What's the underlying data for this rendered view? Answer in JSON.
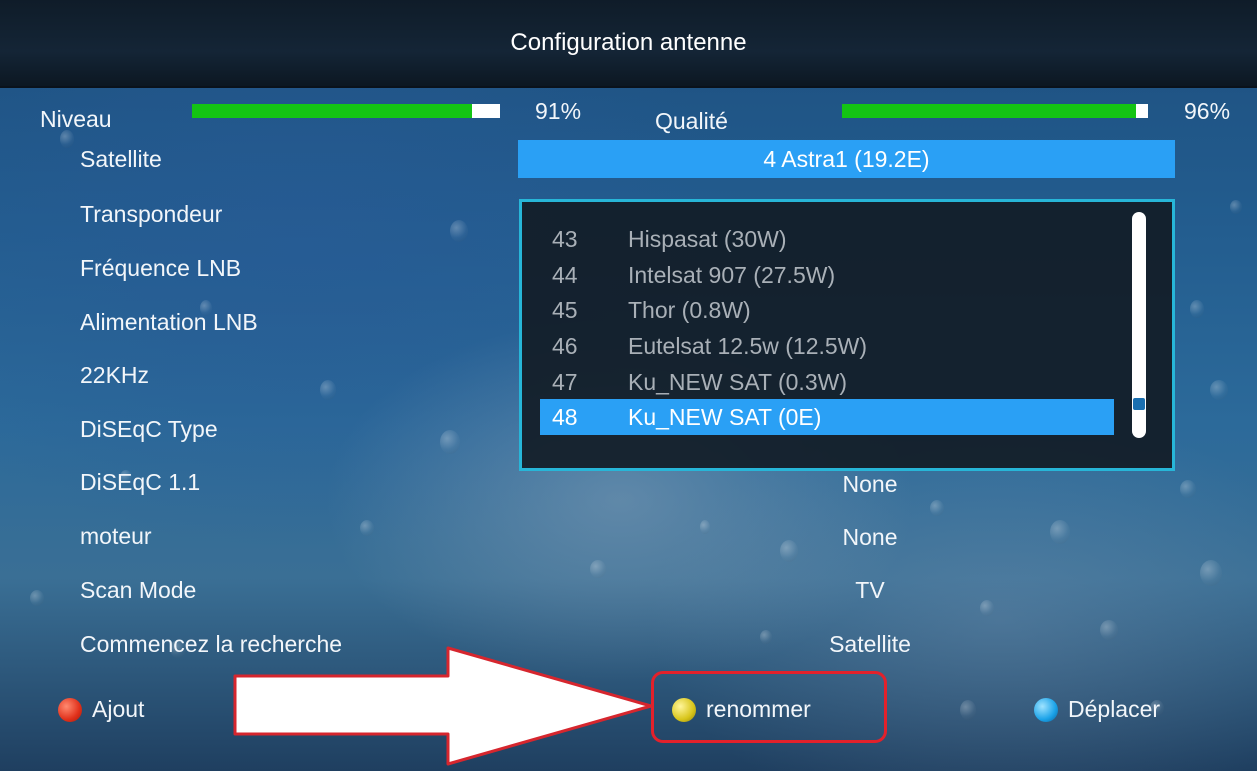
{
  "header": {
    "title": "Configuration antenne"
  },
  "signal": {
    "level_label": "Niveau",
    "level_value": "91%",
    "level_fraction": 0.91,
    "quality_label": "Qualité",
    "quality_value": "96%",
    "quality_fraction": 0.96,
    "bar_fill_color": "#14c414"
  },
  "settings": [
    {
      "label": "Satellite"
    },
    {
      "label": "Transpondeur"
    },
    {
      "label": "Fréquence LNB"
    },
    {
      "label": "Alimentation LNB"
    },
    {
      "label": "22KHz"
    },
    {
      "label": "DiSEqC Type"
    },
    {
      "label": "DiSEqC 1.1",
      "value": "None"
    },
    {
      "label": "moteur",
      "value": "None"
    },
    {
      "label": "Scan Mode",
      "value": "TV"
    },
    {
      "label": "Commencez la recherche",
      "value": "Satellite"
    }
  ],
  "satellite_field": {
    "value": "4 Astra1 (19.2E)"
  },
  "satellite_list": [
    {
      "num": "43",
      "name": "Hispasat (30W)"
    },
    {
      "num": "44",
      "name": "Intelsat 907 (27.5W)"
    },
    {
      "num": "45",
      "name": "Thor (0.8W)"
    },
    {
      "num": "46",
      "name": "Eutelsat 12.5w (12.5W)"
    },
    {
      "num": "47",
      "name": "Ku_NEW SAT (0.3W)"
    },
    {
      "num": "48",
      "name": "Ku_NEW SAT (0E)",
      "selected": true
    }
  ],
  "footer": {
    "red": {
      "label": "Ajout",
      "icon": "red-button-icon"
    },
    "yellow": {
      "label": "renommer",
      "icon": "yellow-button-icon"
    },
    "blue": {
      "label": "Déplacer",
      "icon": "blue-button-icon"
    }
  },
  "colors": {
    "accent": "#2aa0f5",
    "list_border": "#27b6d8",
    "highlight": "#e3212b"
  }
}
